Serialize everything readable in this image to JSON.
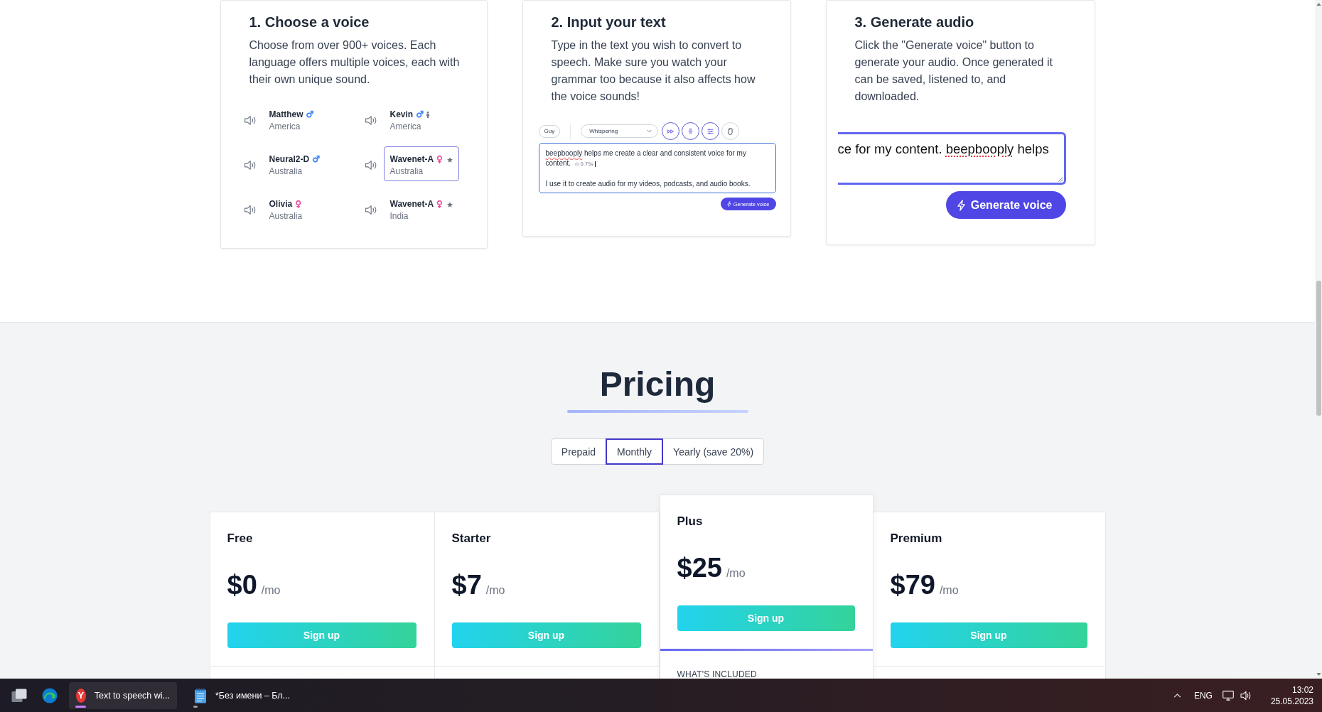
{
  "steps": [
    {
      "kind": "voices",
      "title": "1. Choose a voice",
      "description": "Choose from over 900+ voices. Each language offers multiple voices, each with their own unique sound.",
      "voices": [
        {
          "name": "Matthew",
          "gender_symbol": "♂",
          "color": "#3b82f6",
          "country": "America",
          "child": false,
          "premium": false,
          "selected": false
        },
        {
          "name": "Kevin",
          "gender_symbol": "♂",
          "color": "#3b82f6",
          "country": "America",
          "child": true,
          "premium": false,
          "selected": false
        },
        {
          "name": "Neural2-D",
          "gender_symbol": "♂",
          "color": "#3b82f6",
          "country": "Australia",
          "child": false,
          "premium": false,
          "selected": false
        },
        {
          "name": "Wavenet-A",
          "gender_symbol": "♀",
          "color": "#ec4899",
          "country": "Australia",
          "child": false,
          "premium": true,
          "selected": true
        },
        {
          "name": "Olivia",
          "gender_symbol": "♀",
          "color": "#ec4899",
          "country": "Australia",
          "child": false,
          "premium": false,
          "selected": false
        },
        {
          "name": "Wavenet-A",
          "gender_symbol": "♀",
          "color": "#ec4899",
          "country": "India",
          "child": false,
          "premium": true,
          "selected": false
        }
      ]
    },
    {
      "kind": "editor",
      "title": "2. Input your text",
      "description": "Type in the text you wish to convert to speech. Make sure you watch your grammar too because it also affects how the voice sounds!",
      "voice_chip": "Guy",
      "style_select": "Whispering",
      "tools": [
        {
          "kind": "speed",
          "active": true
        },
        {
          "kind": "pause",
          "active": true
        },
        {
          "kind": "adjust",
          "active": true
        },
        {
          "kind": "hand",
          "active": false
        }
      ],
      "editor": {
        "focused": true,
        "paragraphs": [
          {
            "segments": [
              {
                "text": "beepbooply",
                "misspelled": true
              },
              {
                "text": " helps me create a clear and consistent voice for my content.",
                "misspelled": false
              }
            ],
            "pause": "◷ 0.75s",
            "caret": true
          },
          {
            "segments": [
              {
                "text": "I use it to create audio for my videos, podcasts, and audio books.",
                "misspelled": false
              }
            ],
            "caret": false
          }
        ]
      },
      "button": "Generate voice"
    },
    {
      "kind": "generate",
      "title": "3. Generate audio",
      "description": "Click the \"Generate voice\" button to generate your audio. Once generated it can be saved, listened to, and\ndownloaded.",
      "input": {
        "focused": true,
        "segments": [
          {
            "text": "ce for my content. ",
            "misspelled": false
          },
          {
            "text": "beepbooply",
            "misspelled": true
          },
          {
            "text": " helps",
            "misspelled": false
          }
        ]
      },
      "button": "Generate voice"
    }
  ],
  "pricing": {
    "title": "Pricing",
    "billing": [
      {
        "label": "Prepaid",
        "selected": false
      },
      {
        "label": "Monthly",
        "selected": true
      },
      {
        "label": "Yearly (save 20%)",
        "selected": false
      }
    ],
    "plans": [
      {
        "name": "Free",
        "price": "$0",
        "period": "/mo",
        "button": "Sign up",
        "featured": false
      },
      {
        "name": "Starter",
        "price": "$7",
        "period": "/mo",
        "button": "Sign up",
        "featured": false
      },
      {
        "name": "Plus",
        "price": "$25",
        "period": "/mo",
        "button": "Sign up",
        "featured": true,
        "included_heading": "WHAT'S INCLUDED"
      },
      {
        "name": "Premium",
        "price": "$79",
        "period": "/mo",
        "button": "Sign up",
        "featured": false
      }
    ]
  },
  "taskbar": {
    "windows": [
      {
        "kind": "browser",
        "logo_letter": "Y",
        "label": "Text to speech wi...",
        "active": true
      },
      {
        "kind": "notepad",
        "label": "*Без имени – Бл...",
        "active": false
      }
    ],
    "language": "ENG",
    "time": "13:02",
    "date": "25.05.2023"
  }
}
